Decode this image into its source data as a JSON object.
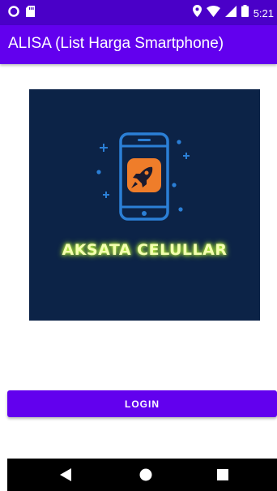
{
  "status_bar": {
    "time": "5:21",
    "icons": [
      "circle-notification-icon",
      "sd-card-icon",
      "location-icon",
      "wifi-icon",
      "signal-icon",
      "battery-icon"
    ],
    "background": "#4a00c8"
  },
  "app_bar": {
    "title": "ALISA (List Harga Smartphone)",
    "background": "#6200ee"
  },
  "logo": {
    "text": "AKSATA CELULLAR",
    "background": "#0c2347",
    "accent": "#ef7d2a",
    "icons": [
      "smartphone-icon",
      "rocket-icon"
    ]
  },
  "login": {
    "label": "LOGIN",
    "color": "#6200ee"
  },
  "nav_bar": {
    "icons": [
      "back-icon",
      "home-icon",
      "recents-icon"
    ]
  }
}
